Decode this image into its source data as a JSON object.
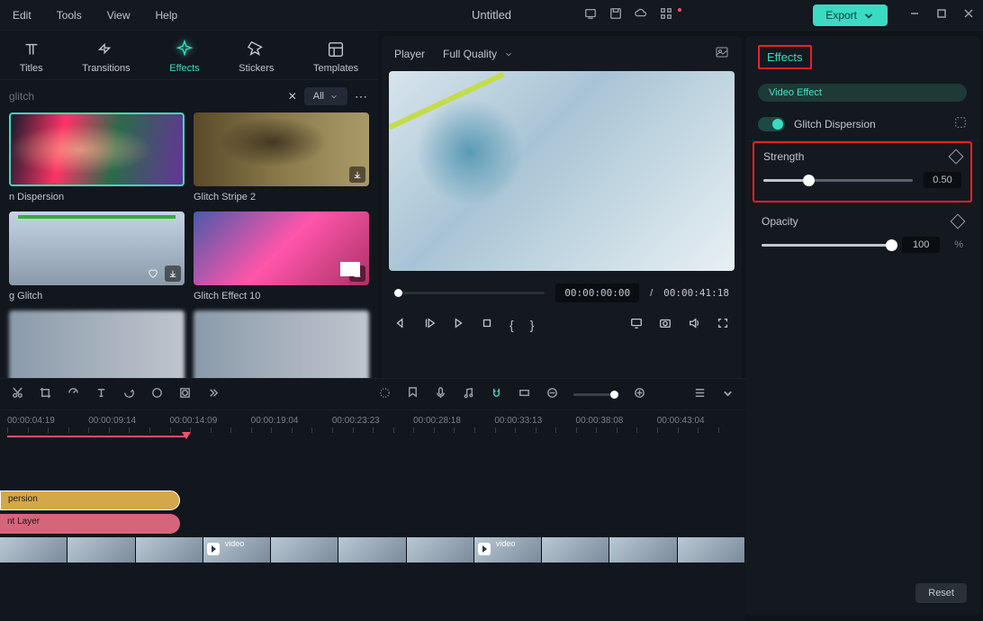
{
  "menu": {
    "edit": "Edit",
    "tools": "Tools",
    "view": "View",
    "help": "Help"
  },
  "doc_title": "Untitled",
  "export_btn": "Export",
  "leftnav": {
    "titles": "Titles",
    "transitions": "Transitions",
    "effects": "Effects",
    "stickers": "Stickers",
    "templates": "Templates"
  },
  "filter": {
    "search_text": "glitch",
    "all": "All"
  },
  "effects": [
    {
      "name": "Glitch Dispersion",
      "label": "n Dispersion"
    },
    {
      "name": "Glitch Stripe 2",
      "label": "Glitch Stripe 2"
    },
    {
      "name": "g Glitch",
      "label": "g Glitch"
    },
    {
      "name": "Glitch Effect 10",
      "label": "Glitch Effect 10"
    }
  ],
  "player": {
    "label": "Player",
    "quality": "Full Quality",
    "current": "00:00:00:00",
    "total": "00:00:41:18"
  },
  "right_panel": {
    "tab": "Effects",
    "video_effect": "Video Effect",
    "effect_name": "Glitch Dispersion",
    "strength": {
      "label": "Strength",
      "value": "0.50",
      "pct": 30
    },
    "opacity": {
      "label": "Opacity",
      "value": "100",
      "unit": "%",
      "pct": 100
    },
    "reset": "Reset"
  },
  "timeline": {
    "ruler": [
      "00:00:04:19",
      "00:00:09:14",
      "00:00:14:09",
      "00:00:19:04",
      "00:00:23:23",
      "00:00:28:18",
      "00:00:33:13",
      "00:00:38:08",
      "00:00:43:04"
    ],
    "clip1": "persion",
    "clip2": "nt Layer",
    "vlabel": "video"
  }
}
